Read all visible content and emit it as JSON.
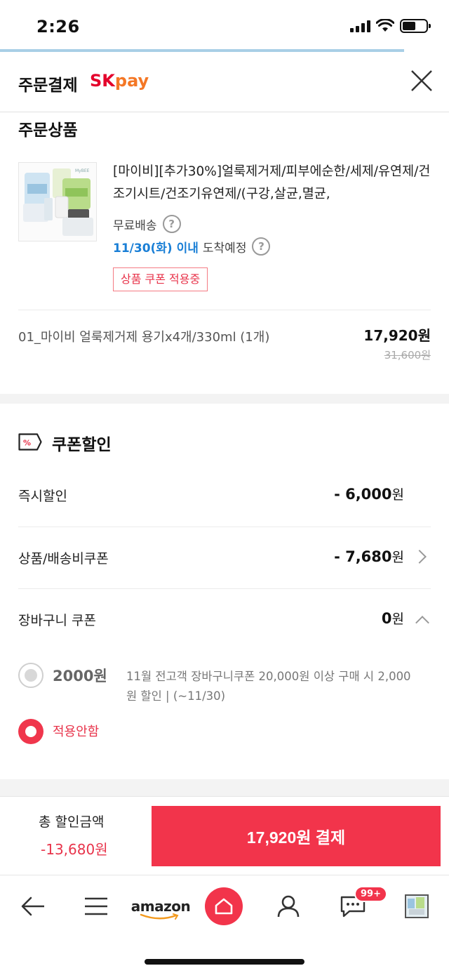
{
  "status": {
    "time": "2:26"
  },
  "header": {
    "title": "주문결제",
    "brand_sk": "SK",
    "brand_pay": "pay"
  },
  "product_section": {
    "title": "주문상품",
    "product_name": "[마이비][추가30%]얼룩제거제/피부에순한/세제/유연제/건조기시트/건조기유연제/(구강,살균,멸균,",
    "shipping": "무료배송",
    "arrival_date": "11/30(화) 이내",
    "arrival_text": "도착예정",
    "coupon_badge": "상품 쿠폰 적용중",
    "option_name": "01_마이비 얼룩제거제 용기x4개/330ml (1개)",
    "option_price": "17,920원",
    "option_original_price": "31,600원",
    "thumb_brand": "MyBEE"
  },
  "coupon_section": {
    "title": "쿠폰할인",
    "icon_text": "%",
    "rows": [
      {
        "label": "즉시할인",
        "value": "- 6,000",
        "unit": "원"
      },
      {
        "label": "상품/배송비쿠폰",
        "value": "- 7,680",
        "unit": "원"
      },
      {
        "label": "장바구니 쿠폰",
        "value": "0",
        "unit": "원"
      }
    ],
    "cart_coupon": {
      "amount": "2000원",
      "description": "11월 전고객 장바구니쿠폰 20,000원 이상 구매 시 2,000원 할인 | (~11/30)",
      "not_applied": "적용안함"
    }
  },
  "bottom_bar": {
    "total_discount_label": "총 할인금액",
    "total_discount_value": "-13,680원",
    "pay_button": "17,920원 결제"
  },
  "nav": {
    "amazon": "amazon",
    "badge": "99+"
  },
  "colors": {
    "accent": "#f2344b",
    "link_blue": "#1a7fd6",
    "sk_red": "#e4002b",
    "pay_orange": "#f47725"
  }
}
